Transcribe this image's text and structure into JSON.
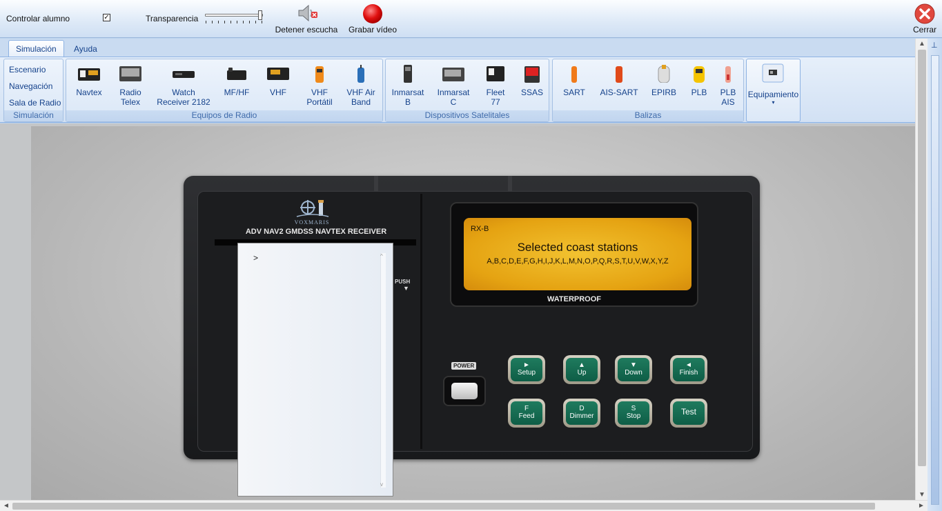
{
  "toolbar": {
    "student_control_label": "Controlar alumno",
    "student_control_checked": true,
    "transparency_label": "Transparencia",
    "transparency_value": 1.0,
    "stop_listen_label": "Detener escucha",
    "record_video_label": "Grabar vídeo",
    "close_label": "Cerrar"
  },
  "tabs": [
    "Simulación",
    "Ayuda"
  ],
  "ribbon": {
    "simulation_group": {
      "caption": "Simulación",
      "links": [
        "Escenario",
        "Navegación",
        "Sala de Radio"
      ]
    },
    "radio_group": {
      "caption": "Equipos de Radio",
      "items": [
        {
          "l1": "Navtex",
          "l2": ""
        },
        {
          "l1": "Radio",
          "l2": "Telex"
        },
        {
          "l1": "Watch",
          "l2": "Receiver 2182"
        },
        {
          "l1": "MF/HF",
          "l2": ""
        },
        {
          "l1": "VHF",
          "l2": ""
        },
        {
          "l1": "VHF",
          "l2": "Portátil"
        },
        {
          "l1": "VHF Air",
          "l2": "Band"
        }
      ]
    },
    "sat_group": {
      "caption": "Dispositivos Satelitales",
      "items": [
        {
          "l1": "Inmarsat",
          "l2": "B"
        },
        {
          "l1": "Inmarsat",
          "l2": "C"
        },
        {
          "l1": "Fleet",
          "l2": "77"
        },
        {
          "l1": "SSAS",
          "l2": ""
        }
      ]
    },
    "beacon_group": {
      "caption": "Balizas",
      "items": [
        {
          "l1": "SART",
          "l2": ""
        },
        {
          "l1": "AIS-SART",
          "l2": ""
        },
        {
          "l1": "EPIRB",
          "l2": ""
        },
        {
          "l1": "PLB",
          "l2": ""
        },
        {
          "l1": "PLB",
          "l2": "AIS"
        }
      ]
    },
    "equipment_label": "Equipamiento"
  },
  "device": {
    "brand": "VOXMARIS",
    "model": "ADV NAV2 GMDSS NAVTEX RECEIVER",
    "push_label": "PUSH",
    "waterproof_label": "WATERPROOF",
    "power_label": "POWER",
    "lcd": {
      "line1": "RX-B",
      "line2": "Selected coast stations",
      "line3": "A,B,C,D,E,F,G,H,I,J,K,L,M,N,O,P,Q,R,S,T,U,V,W,X,Y,Z"
    },
    "keys_row1": [
      {
        "top": "►",
        "bottom": "Setup"
      },
      {
        "top": "▲",
        "bottom": "Up"
      },
      {
        "top": "▼",
        "bottom": "Down"
      },
      {
        "top": "◄",
        "bottom": "Finish"
      }
    ],
    "keys_row2": [
      {
        "top": "F",
        "bottom": "Feed"
      },
      {
        "top": "D",
        "bottom": "Dimmer"
      },
      {
        "top": "S",
        "bottom": "Stop"
      },
      {
        "top": "",
        "bottom": "Test"
      }
    ],
    "paper_text": ">"
  },
  "colors": {
    "ribbon_text": "#15428b",
    "lcd_amber": "#e5a312",
    "key_green": "#0e5d46",
    "record_red": "#e01010"
  }
}
